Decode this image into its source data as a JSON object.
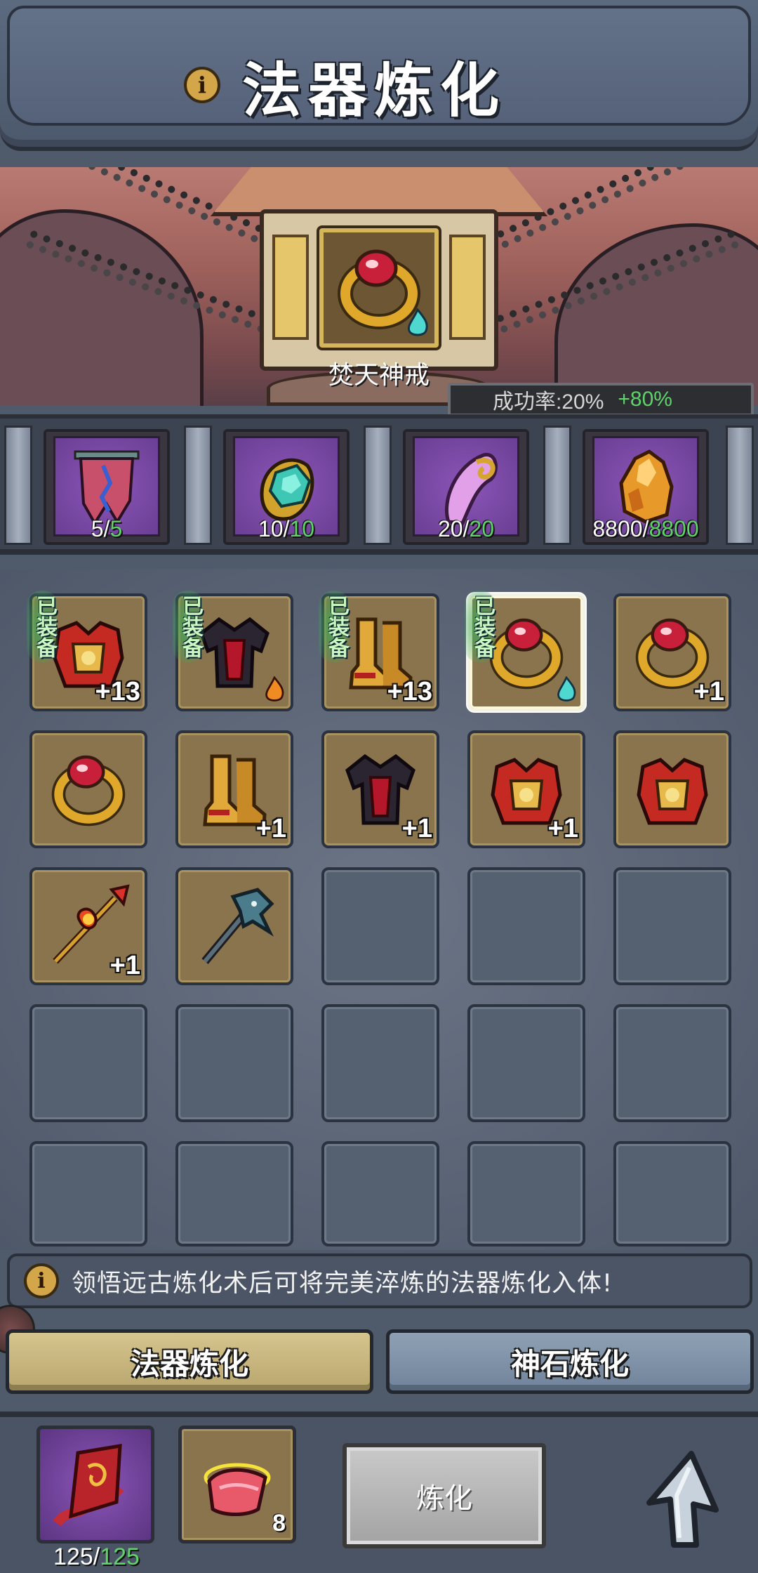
{
  "header": {
    "title": "法器炼化",
    "info_icon": "i"
  },
  "target": {
    "name": "焚天神戒",
    "icon": "gold-ring-red-gem-icon",
    "success_rate_label": "成功率:20%",
    "success_rate_bonus": "+80%"
  },
  "materials": [
    {
      "icon": "tattered-banner-icon",
      "have": "5/",
      "need": "5"
    },
    {
      "icon": "teal-gem-claw-icon",
      "have": "10/",
      "need": "10"
    },
    {
      "icon": "purple-horn-icon",
      "have": "20/",
      "need": "20"
    },
    {
      "icon": "amber-crystal-icon",
      "have": "8800/",
      "need": "8800"
    }
  ],
  "inventory": {
    "equipped_label": "已装备",
    "items": [
      {
        "icon": "red-gold-chest-armor-icon",
        "level": "+13",
        "equipped": true
      },
      {
        "icon": "dark-red-armor-icon",
        "level": "",
        "equipped": true,
        "badge": "flame"
      },
      {
        "icon": "golden-boots-icon",
        "level": "+13",
        "equipped": true
      },
      {
        "icon": "gold-ring-red-gem-icon",
        "level": "",
        "equipped": true,
        "badge": "teal-flame",
        "selected": true
      },
      {
        "icon": "gold-ring-red-gem-icon",
        "level": "+1",
        "equipped": false
      },
      {
        "icon": "gold-ring-red-gem-icon",
        "level": "",
        "equipped": false
      },
      {
        "icon": "golden-boots-icon",
        "level": "+1",
        "equipped": false
      },
      {
        "icon": "dark-red-armor-icon",
        "level": "+1",
        "equipped": false
      },
      {
        "icon": "red-gold-chest-armor-icon",
        "level": "+1",
        "equipped": false
      },
      {
        "icon": "red-gold-chest-armor-icon",
        "level": "",
        "equipped": false
      },
      {
        "icon": "flame-spear-icon",
        "level": "+1",
        "equipped": false
      },
      {
        "icon": "dragon-pickaxe-icon",
        "level": "",
        "equipped": false
      }
    ]
  },
  "tip": {
    "text": "领悟远古炼化术后可将完美淬炼的法器炼化入体!"
  },
  "tabs": {
    "artifact_label": "法器炼化",
    "stone_label": "神石炼化"
  },
  "bottom": {
    "scroll_have": "125/",
    "scroll_need": "125",
    "scroll_icon": "flame-scroll-icon",
    "cloth_icon": "glowing-cloth-icon",
    "cloth_qty": "8",
    "refine_label": "炼化",
    "back_icon": "back-arrow-icon"
  }
}
